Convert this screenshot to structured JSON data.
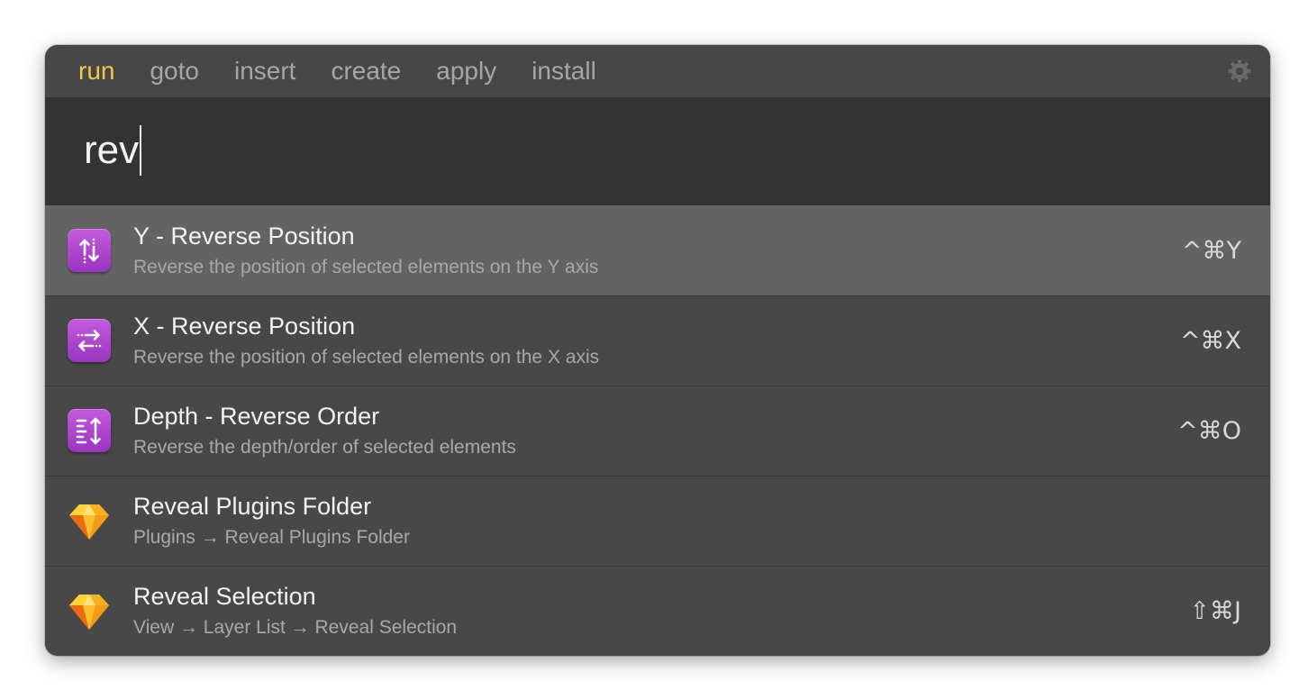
{
  "tabs": [
    {
      "label": "run",
      "active": true
    },
    {
      "label": "goto",
      "active": false
    },
    {
      "label": "insert",
      "active": false
    },
    {
      "label": "create",
      "active": false
    },
    {
      "label": "apply",
      "active": false
    },
    {
      "label": "install",
      "active": false
    }
  ],
  "settings_icon": "gear-icon",
  "search": {
    "value": "rev"
  },
  "colors": {
    "active_tab": "#f5c744",
    "selected_row": "#636363",
    "plugin_icon": "#b14bd6",
    "sketch_icon": "#f7a51d"
  },
  "results": [
    {
      "title": "Y - Reverse Position",
      "subtitle": "Reverse the position of selected elements on the Y axis",
      "shortcut": "^⌘Y",
      "icon": "reverse-y-icon",
      "selected": true
    },
    {
      "title": "X - Reverse Position",
      "subtitle": "Reverse the position of selected elements on the X axis",
      "shortcut": "^⌘X",
      "icon": "reverse-x-icon",
      "selected": false
    },
    {
      "title": "Depth - Reverse Order",
      "subtitle": "Reverse the depth/order of selected elements",
      "shortcut": "^⌘O",
      "icon": "reverse-order-icon",
      "selected": false
    },
    {
      "title": "Reveal Plugins Folder",
      "subtitle": "Plugins → Reveal Plugins Folder",
      "shortcut": "",
      "icon": "sketch-diamond-icon",
      "selected": false
    },
    {
      "title": "Reveal Selection",
      "subtitle": "View → Layer List → Reveal Selection",
      "shortcut": "⇧⌘J",
      "icon": "sketch-diamond-icon",
      "selected": false
    }
  ]
}
